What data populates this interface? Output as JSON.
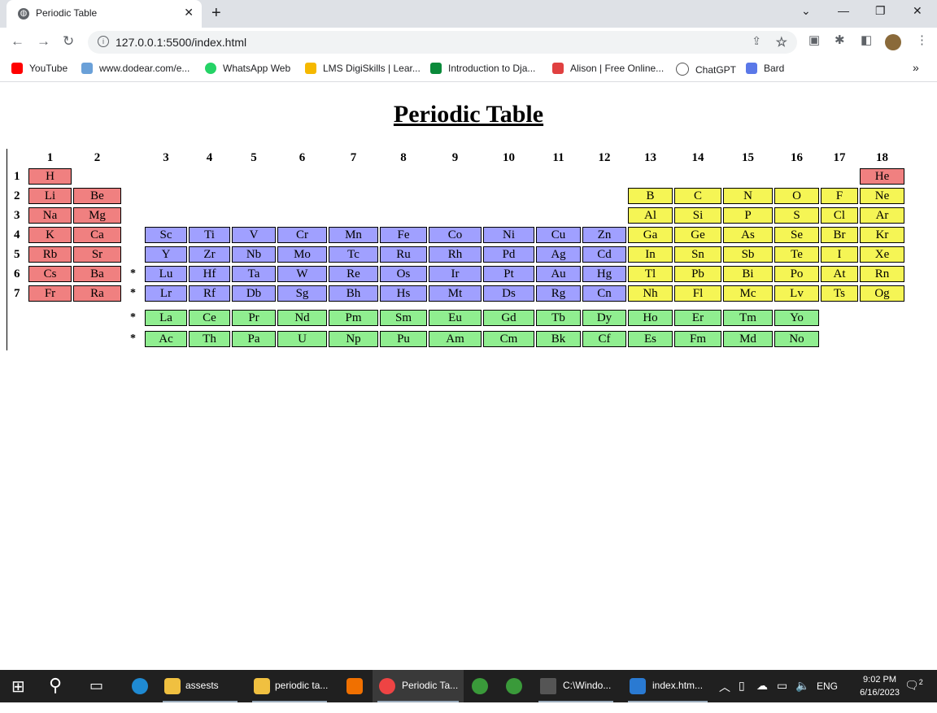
{
  "browser": {
    "tab_title": "Periodic Table",
    "url": "127.0.0.1:5500/index.html",
    "bookmarks": [
      "YouTube",
      "www.dodear.com/e...",
      "WhatsApp Web",
      "LMS DigiSkills | Lear...",
      "Introduction to Dja...",
      "Alison | Free Online...",
      "ChatGPT",
      "Bard"
    ]
  },
  "page": {
    "title": "Periodic Table"
  },
  "table": {
    "groups": [
      "1",
      "2",
      "3",
      "4",
      "5",
      "6",
      "7",
      "8",
      "9",
      "10",
      "11",
      "12",
      "13",
      "14",
      "15",
      "16",
      "17",
      "18"
    ],
    "periods": [
      "1",
      "2",
      "3",
      "4",
      "5",
      "6",
      "7"
    ],
    "star": "*",
    "colors": {
      "alkali": "#f08080",
      "transition": "#a0a0ff",
      "p_block": "#f5f555",
      "f_block": "#90ee90"
    },
    "rows": [
      [
        "H",
        "",
        "",
        "",
        "",
        "",
        "",
        "",
        "",
        "",
        "",
        "",
        "",
        "",
        "",
        "",
        "",
        "He"
      ],
      [
        "Li",
        "Be",
        "",
        "",
        "",
        "",
        "",
        "",
        "",
        "",
        "",
        "",
        "B",
        "C",
        "N",
        "O",
        "F",
        "Ne"
      ],
      [
        "Na",
        "Mg",
        "",
        "",
        "",
        "",
        "",
        "",
        "",
        "",
        "",
        "",
        "Al",
        "Si",
        "P",
        "S",
        "Cl",
        "Ar"
      ],
      [
        "K",
        "Ca",
        "Sc",
        "Ti",
        "V",
        "Cr",
        "Mn",
        "Fe",
        "Co",
        "Ni",
        "Cu",
        "Zn",
        "Ga",
        "Ge",
        "As",
        "Se",
        "Br",
        "Kr"
      ],
      [
        "Rb",
        "Sr",
        "Y",
        "Zr",
        "Nb",
        "Mo",
        "Tc",
        "Ru",
        "Rh",
        "Pd",
        "Ag",
        "Cd",
        "In",
        "Sn",
        "Sb",
        "Te",
        "I",
        "Xe"
      ],
      [
        "Cs",
        "Ba",
        "Lu",
        "Hf",
        "Ta",
        "W",
        "Re",
        "Os",
        "Ir",
        "Pt",
        "Au",
        "Hg",
        "Tl",
        "Pb",
        "Bi",
        "Po",
        "At",
        "Rn"
      ],
      [
        "Fr",
        "Ra",
        "Lr",
        "Rf",
        "Db",
        "Sg",
        "Bh",
        "Hs",
        "Mt",
        "Ds",
        "Rg",
        "Cn",
        "Nh",
        "Fl",
        "Mc",
        "Lv",
        "Ts",
        "Og"
      ]
    ],
    "lanthanides": [
      "La",
      "Ce",
      "Pr",
      "Nd",
      "Pm",
      "Sm",
      "Eu",
      "Gd",
      "Tb",
      "Dy",
      "Ho",
      "Er",
      "Tm",
      "Yo"
    ],
    "actinides": [
      "Ac",
      "Th",
      "Pa",
      "U",
      "Np",
      "Pu",
      "Am",
      "Cm",
      "Bk",
      "Cf",
      "Es",
      "Fm",
      "Md",
      "No"
    ]
  },
  "taskbar": {
    "items": [
      "assests",
      "periodic ta...",
      "Periodic Ta...",
      "C:\\Windo...",
      "index.htm..."
    ],
    "lang": "ENG",
    "time": "9:02 PM",
    "date": "6/16/2023",
    "notifications": "2"
  }
}
